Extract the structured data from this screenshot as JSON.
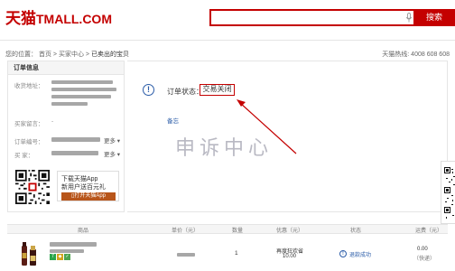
{
  "header": {
    "logo_cn": "天猫",
    "logo_en": "TMALL.COM",
    "search": {
      "value": "",
      "button_label": "搜索"
    }
  },
  "breadcrumb": {
    "prefix": "您的位置：",
    "items": [
      "首页",
      "买家中心",
      "已卖出的宝贝"
    ],
    "separator": " > "
  },
  "hotline": "天猫热线: 4008 608 608",
  "order_info": {
    "title": "订单信息",
    "labels": {
      "address": "收货地址：",
      "message": "买家留言：",
      "message_value": "-",
      "order_no": "订单编号：",
      "seller": "买    家："
    },
    "more_label": "更多",
    "app_promo": {
      "line1": "下载天猫App",
      "line2": "新用户送百元礼",
      "button": "打开天猫App"
    }
  },
  "status": {
    "label": "订单状态：",
    "value": "交易关闭",
    "remark_link": "备忘"
  },
  "watermark": "申诉中心",
  "table": {
    "headers": [
      "商品",
      "单价（元）",
      "数量",
      "优惠（元）",
      "状态",
      "运费（元）"
    ],
    "row": {
      "quantity": "1",
      "discount_label": "再度狂欢省",
      "discount_value": "10.00",
      "refund_status": "退款成功",
      "shipping_value": "0.00",
      "shipping_note": "（快递）"
    }
  },
  "colors": {
    "brand_red": "#c40000",
    "link_blue": "#2b5ca8",
    "watermark_gray": "#b9b9c3",
    "app_button": "#b8551a"
  }
}
